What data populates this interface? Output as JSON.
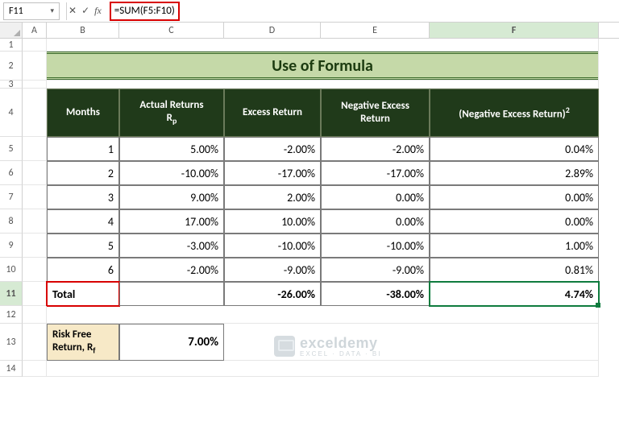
{
  "cell_ref": "F11",
  "formula": "=SUM(F5:F10)",
  "columns": [
    "A",
    "B",
    "C",
    "D",
    "E",
    "F"
  ],
  "row_numbers": [
    "1",
    "2",
    "3",
    "4",
    "5",
    "6",
    "7",
    "8",
    "9",
    "10",
    "11",
    "12",
    "13",
    "14"
  ],
  "title": "Use of Formula",
  "headers": {
    "months": "Months",
    "actual_prefix": "Actual Returns",
    "actual_sub": "p",
    "excess": "Excess Return",
    "neg_excess": "Negative Excess Return",
    "neg_sq_prefix": "(Negative Excess Return)"
  },
  "rows": [
    {
      "m": "1",
      "ar": "5.00%",
      "er": "-2.00%",
      "nr": "-2.00%",
      "sq": "0.04%"
    },
    {
      "m": "2",
      "ar": "-10.00%",
      "er": "-17.00%",
      "nr": "-17.00%",
      "sq": "2.89%"
    },
    {
      "m": "3",
      "ar": "9.00%",
      "er": "2.00%",
      "nr": "0.00%",
      "sq": "0.00%"
    },
    {
      "m": "4",
      "ar": "17.00%",
      "er": "10.00%",
      "nr": "0.00%",
      "sq": "0.00%"
    },
    {
      "m": "5",
      "ar": "-3.00%",
      "er": "-10.00%",
      "nr": "-10.00%",
      "sq": "1.00%"
    },
    {
      "m": "6",
      "ar": "-2.00%",
      "er": "-9.00%",
      "nr": "-9.00%",
      "sq": "0.81%"
    }
  ],
  "total": {
    "label": "Total",
    "er": "-26.00%",
    "nr": "-38.00%",
    "sq": "4.74%"
  },
  "risk_free": {
    "label_line1": "Risk Free",
    "label_line2_prefix": "Return, R",
    "label_sub": "f",
    "value": "7.00%"
  },
  "watermark": {
    "name": "exceldemy",
    "tag": "EXCEL · DATA · BI"
  },
  "chart_data": {
    "type": "table",
    "title": "Use of Formula",
    "columns": [
      "Months",
      "Actual Returns Rp",
      "Excess Return",
      "Negative Excess Return",
      "(Negative Excess Return)^2"
    ],
    "data": [
      [
        1,
        0.05,
        -0.02,
        -0.02,
        0.0004
      ],
      [
        2,
        -0.1,
        -0.17,
        -0.17,
        0.0289
      ],
      [
        3,
        0.09,
        0.02,
        0.0,
        0.0
      ],
      [
        4,
        0.17,
        0.1,
        0.0,
        0.0
      ],
      [
        5,
        -0.03,
        -0.1,
        -0.1,
        0.01
      ],
      [
        6,
        -0.02,
        -0.09,
        -0.09,
        0.0081
      ]
    ],
    "totals": {
      "Excess Return": -0.26,
      "Negative Excess Return": -0.38,
      "(Negative Excess Return)^2": 0.0474
    },
    "risk_free_return": 0.07
  }
}
